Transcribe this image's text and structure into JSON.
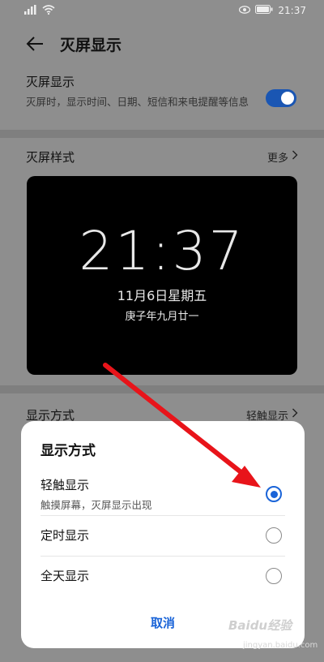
{
  "status_bar": {
    "time": "21:37"
  },
  "app_bar": {
    "title": "灭屏显示"
  },
  "main_setting": {
    "title": "灭屏显示",
    "description": "灭屏时，显示时间、日期、短信和来电提醒等信息",
    "enabled": true
  },
  "style_section": {
    "title": "灭屏样式",
    "more_label": "更多"
  },
  "preview": {
    "time": "21:37",
    "date": "11月6日星期五",
    "lunar": "庚子年九月廿一"
  },
  "display_mode_row": {
    "title": "显示方式",
    "value": "轻触显示"
  },
  "dialog": {
    "title": "显示方式",
    "options": [
      {
        "label": "轻触显示",
        "sub": "触摸屏幕，灭屏显示出现",
        "selected": true
      },
      {
        "label": "定时显示",
        "sub": "",
        "selected": false
      },
      {
        "label": "全天显示",
        "sub": "",
        "selected": false
      }
    ],
    "cancel_label": "取消"
  },
  "annotation": {
    "arrow_color": "#e8141a"
  },
  "watermark": {
    "brand": "Baidu经验",
    "url": "jingyan.baidu.com"
  },
  "colors": {
    "accent": "#1a64d8",
    "overlay": "#8e8e8e"
  }
}
